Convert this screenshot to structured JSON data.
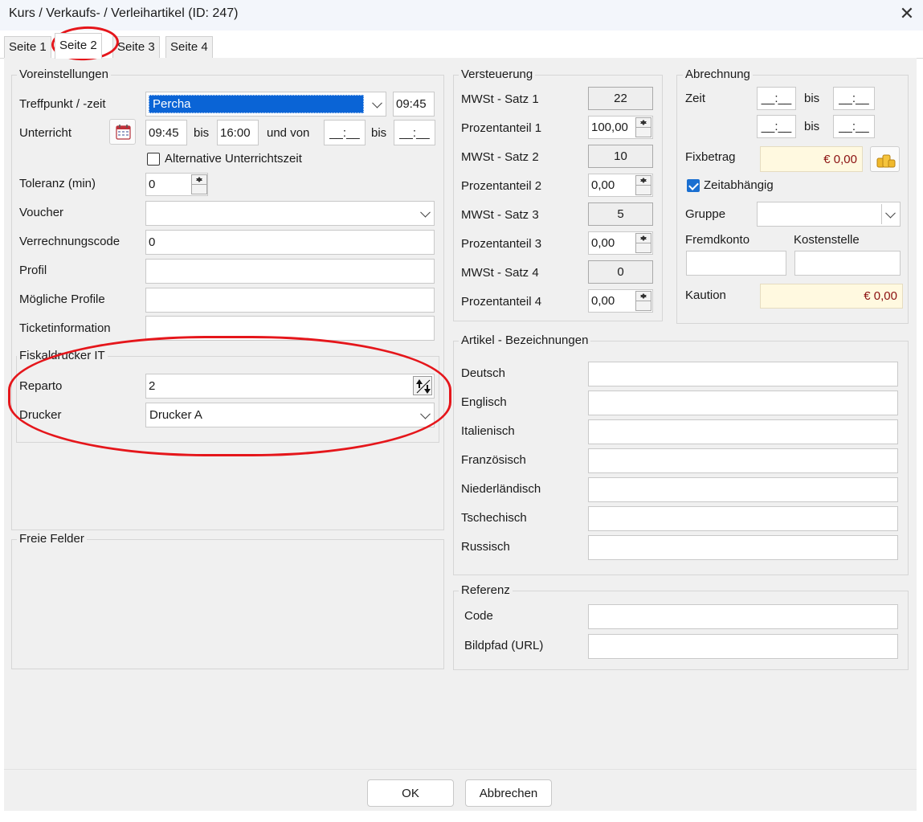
{
  "window": {
    "title": "Kurs / Verkaufs- / Verleihartikel (ID: 247)",
    "close_glyph": "✕"
  },
  "tabs": [
    "Seite 1",
    "Seite 2",
    "Seite 3",
    "Seite 4"
  ],
  "voreinstellungen": {
    "legend": "Voreinstellungen",
    "treffpunkt_label": "Treffpunkt / -zeit",
    "treffpunkt_value": "Percha",
    "treffpunkt_time": "09:45",
    "unterricht_label": "Unterricht",
    "unterricht_from": "09:45",
    "unterricht_bis1": "bis",
    "unterricht_to": "16:00",
    "und_von": "und von",
    "unterricht_from2": "__:__",
    "unterricht_bis2": "bis",
    "unterricht_to2": "__:__",
    "alternative_label": "Alternative Unterrichtszeit",
    "toleranz_label": "Toleranz (min)",
    "toleranz_value": "0",
    "voucher_label": "Voucher",
    "voucher_value": "",
    "verrechnungscode_label": "Verrechnungscode",
    "verrechnungscode_value": "0",
    "profil_label": "Profil",
    "profil_value": "",
    "moegliche_profile_label": "Mögliche Profile",
    "moegliche_profile_value": "",
    "ticketinformation_label": "Ticketinformation",
    "ticketinformation_value": ""
  },
  "fiskaldrucker": {
    "legend": "Fiskaldrucker IT",
    "reparto_label": "Reparto",
    "reparto_value": "2",
    "drucker_label": "Drucker",
    "drucker_value": "Drucker A"
  },
  "freie_felder": {
    "legend": "Freie Felder"
  },
  "versteuerung": {
    "legend": "Versteuerung",
    "rows": [
      {
        "label": "MWSt - Satz 1",
        "value": "22"
      },
      {
        "label": "Prozentanteil 1",
        "value": "100,00"
      },
      {
        "label": "MWSt - Satz 2",
        "value": "10"
      },
      {
        "label": "Prozentanteil 2",
        "value": "0,00"
      },
      {
        "label": "MWSt - Satz 3",
        "value": "5"
      },
      {
        "label": "Prozentanteil 3",
        "value": "0,00"
      },
      {
        "label": "MWSt - Satz 4",
        "value": "0"
      },
      {
        "label": "Prozentanteil 4",
        "value": "0,00"
      }
    ]
  },
  "abrechnung": {
    "legend": "Abrechnung",
    "zeit_label": "Zeit",
    "bis_label": "bis",
    "time_placeholder": "__:__",
    "fixbetrag_label": "Fixbetrag",
    "fixbetrag_value": "€ 0,00",
    "zeitabhaengig_label": "Zeitabhängig",
    "zeitabhaengig_checked": true,
    "gruppe_label": "Gruppe",
    "fremdkonto_label": "Fremdkonto",
    "kostenstelle_label": "Kostenstelle",
    "kaution_label": "Kaution",
    "kaution_value": "€ 0,00"
  },
  "artikel_bezeichnungen": {
    "legend": "Artikel - Bezeichnungen",
    "languages": [
      "Deutsch",
      "Englisch",
      "Italienisch",
      "Französisch",
      "Niederländisch",
      "Tschechisch",
      "Russisch"
    ]
  },
  "referenz": {
    "legend": "Referenz",
    "code_label": "Code",
    "bildpfad_label": "Bildpfad (URL)"
  },
  "footer": {
    "ok_label": "OK",
    "cancel_label": "Abbrechen"
  },
  "colors": {
    "selection": "#0a64d6",
    "annotation_red": "#e5161b",
    "checkbox_blue": "#1a6fd1"
  }
}
